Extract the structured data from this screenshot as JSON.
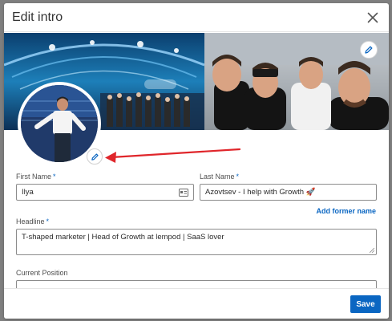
{
  "modal": {
    "title": "Edit intro"
  },
  "form": {
    "first_name": {
      "label": "First Name",
      "required_mark": "*",
      "value": "Ilya"
    },
    "last_name": {
      "label": "Last Name",
      "required_mark": "*",
      "value": "Azovtsev - I help with Growth 🚀"
    },
    "add_former_name": "Add former name",
    "headline": {
      "label": "Headline",
      "required_mark": "*",
      "value": "T-shaped marketer | Head of Growth at lempod | SaaS lover"
    },
    "current_position": {
      "label": "Current Position",
      "value": ""
    }
  },
  "footer": {
    "save_label": "Save"
  },
  "colors": {
    "accent": "#0a66c2",
    "annotation_arrow": "#e0262b"
  },
  "icons": {
    "close": "close-icon",
    "edit_banner": "pencil-icon",
    "edit_photo": "pencil-icon",
    "first_name_field": "contact-card-icon"
  }
}
